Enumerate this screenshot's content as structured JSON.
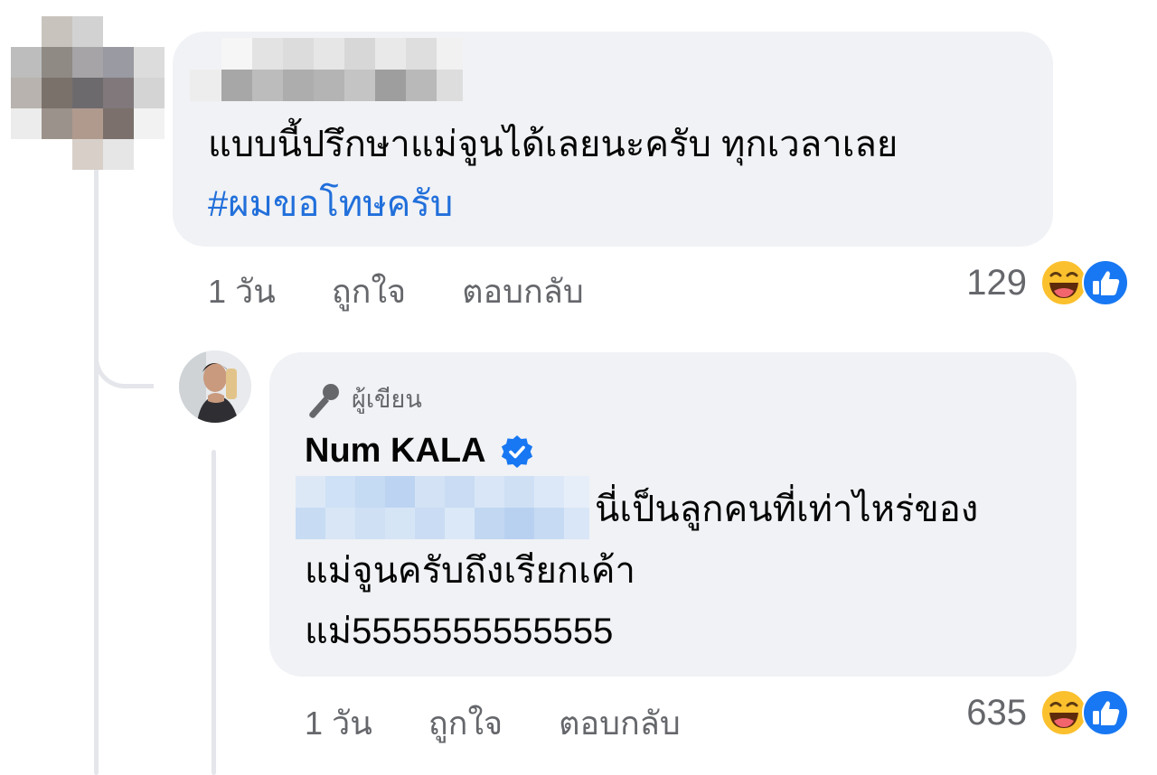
{
  "comment": {
    "author_blurred": true,
    "text_line1": "แบบนี้ปรึกษาแม่จูนได้เลยนะครับ ทุกเวลาเลย",
    "hashtag": "#ผมขอโทษครับ",
    "time": "1 วัน",
    "like_label": "ถูกใจ",
    "reply_label": "ตอบกลับ",
    "reaction_count": "129",
    "reaction_icons": [
      "laughing-emoji-icon",
      "like-thumb-icon"
    ]
  },
  "reply": {
    "badge_label": "ผู้เขียน",
    "badge_icon": "microphone-icon",
    "author_name": "Num KALA",
    "verified": true,
    "text_line1": "นี่เป็นลูกคนที่เท่าไหร่ของ",
    "text_line2": "แม่จูนครับถึงเรียกเค้า",
    "text_line3": "แม่5555555555555",
    "time": "1 วัน",
    "like_label": "ถูกใจ",
    "reply_label": "ตอบกลับ",
    "reaction_count": "635",
    "reaction_icons": [
      "laughing-emoji-icon",
      "like-thumb-icon"
    ]
  },
  "colors": {
    "bubble_bg": "#f0f2f5",
    "hashtag": "#216fdb",
    "meta_text": "#65676b",
    "like_blue": "#1877f2",
    "thread_line": "#e4e6eb"
  }
}
